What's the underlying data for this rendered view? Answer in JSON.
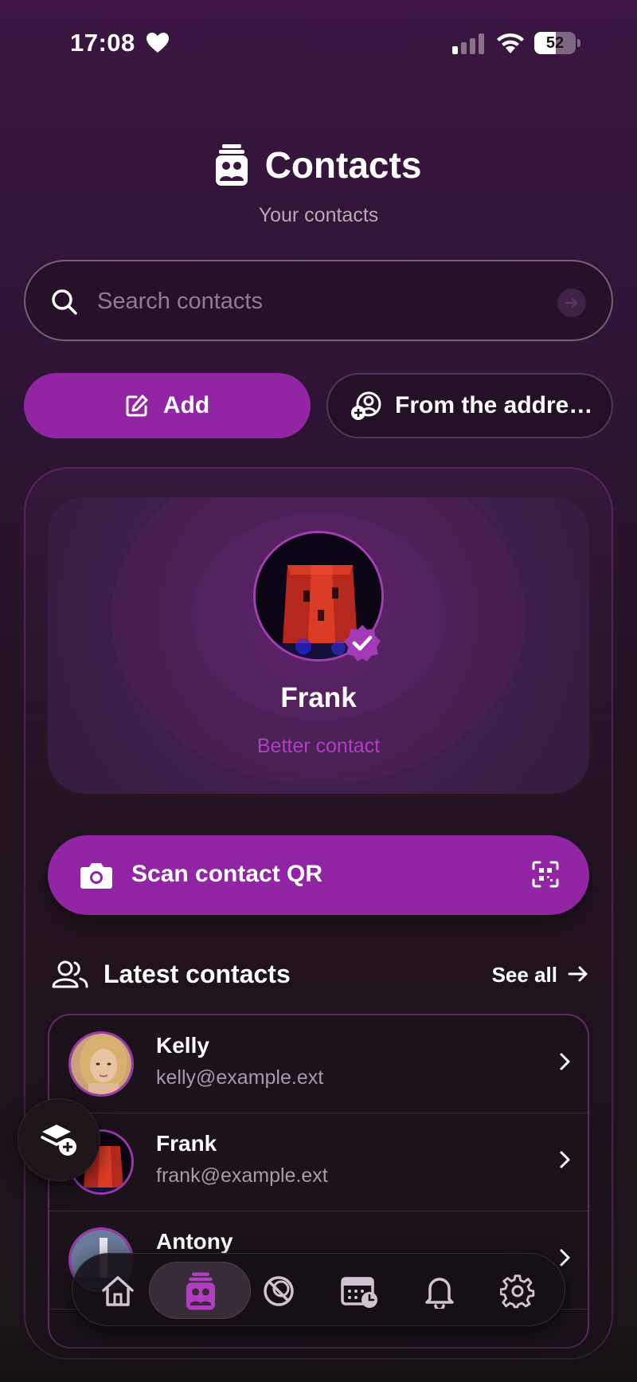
{
  "status_bar": {
    "time": "17:08",
    "battery": "52",
    "battery_level": 0.52
  },
  "header": {
    "title": "Contacts",
    "subtitle": "Your contacts",
    "icon": "contacts-icon"
  },
  "search": {
    "placeholder": "Search contacts",
    "value": ""
  },
  "actions": {
    "add_label": "Add",
    "address_label": "From the addre…"
  },
  "featured": {
    "name": "Frank",
    "role": "Better contact",
    "verified": true
  },
  "scan": {
    "label": "Scan contact QR"
  },
  "latest": {
    "title": "Latest contacts",
    "see_all": "See all",
    "items": [
      {
        "name": "Kelly",
        "email": "kelly@example.ext"
      },
      {
        "name": "Frank",
        "email": "frank@example.ext"
      },
      {
        "name": "Antony",
        "email": ""
      }
    ]
  },
  "nav": {
    "items": [
      "home-icon",
      "contacts-icon",
      "no-pets-icon",
      "calendar-clock-icon",
      "bell-icon",
      "gear-icon"
    ],
    "active": "contacts-icon"
  },
  "colors": {
    "accent": "#9225a3",
    "accent_text": "#b03ec0",
    "background": "#2e1434"
  }
}
